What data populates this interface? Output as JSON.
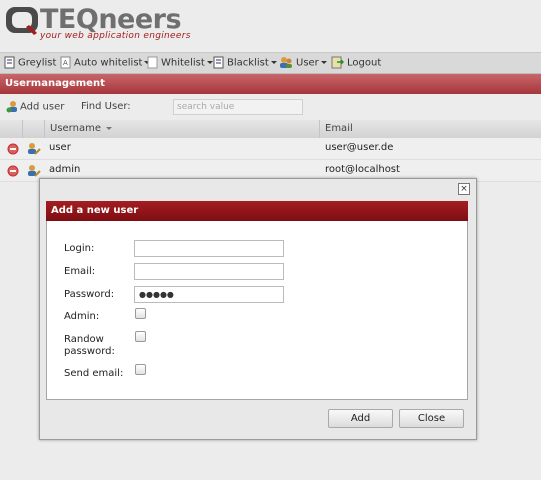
{
  "brand": {
    "logo_main": "TEQneers",
    "tagline": "your web application engineers"
  },
  "menu": {
    "items": [
      {
        "label": "Greylist",
        "icon": "document-icon"
      },
      {
        "label": "Auto whitelist",
        "icon": "document-a-icon",
        "dropdown": true
      },
      {
        "label": "Whitelist",
        "icon": "document-icon",
        "dropdown": true
      },
      {
        "label": "Blacklist",
        "icon": "document-icon",
        "dropdown": true
      },
      {
        "label": "User",
        "icon": "users-icon",
        "dropdown": true
      },
      {
        "label": "Logout",
        "icon": "logout-icon"
      }
    ]
  },
  "panel": {
    "title": "Usermanagement"
  },
  "toolbar": {
    "add_user_label": "Add user",
    "find_label": "Find User:",
    "search_placeholder": "search value"
  },
  "grid": {
    "columns": [
      "Username",
      "Email"
    ],
    "rows": [
      {
        "username": "user",
        "email": "user@user.de"
      },
      {
        "username": "admin",
        "email": "root@localhost"
      }
    ]
  },
  "dialog": {
    "title": "Add a new user",
    "close_symbol": "×",
    "fields": {
      "login_label": "Login:",
      "login_value": "",
      "email_label": "Email:",
      "email_value": "",
      "password_label": "Password:",
      "password_value": "●●●●●",
      "admin_label": "Admin:",
      "random_label_1": "Randow",
      "random_label_2": "password:",
      "send_email_label": "Send email:"
    },
    "buttons": {
      "add": "Add",
      "close": "Close"
    }
  },
  "colors": {
    "accent": "#a51d22",
    "panel_header": "#b24a4f"
  }
}
